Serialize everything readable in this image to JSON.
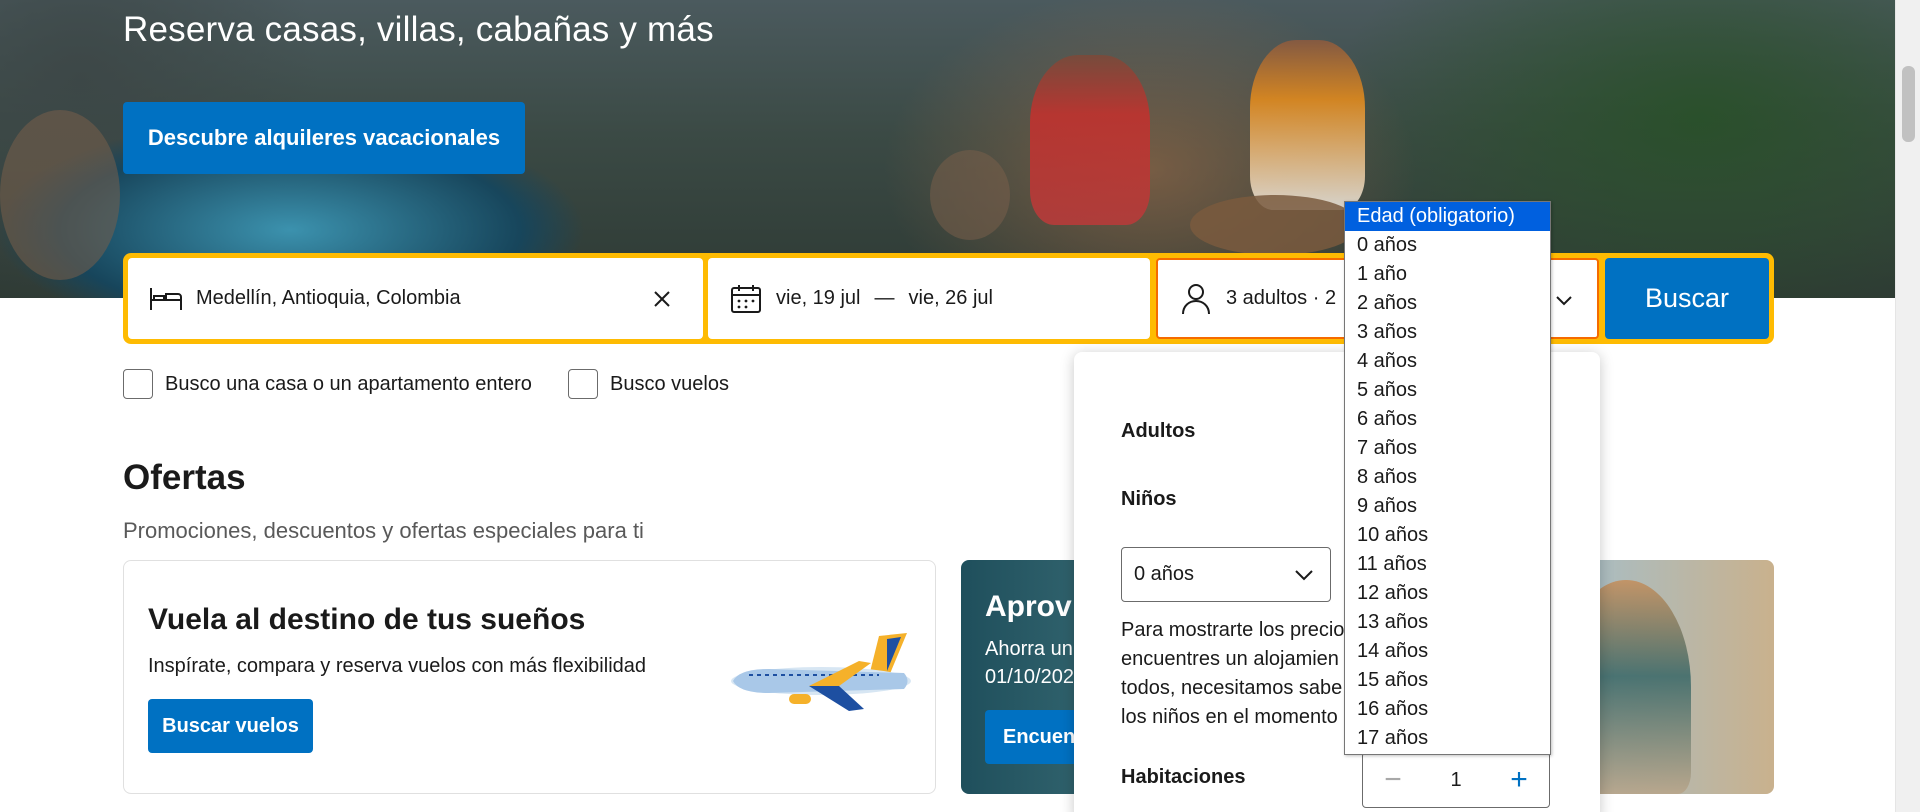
{
  "hero": {
    "title": "Reserva casas, villas, cabañas y más",
    "cta_label": "Descubre alquileres vacacionales"
  },
  "search": {
    "destination": "Medellín, Antioquia, Colombia",
    "check_in": "vie, 19 jul",
    "date_separator": "—",
    "check_out": "vie, 26 jul",
    "guests_summary": "3 adultos · 2",
    "search_label": "Buscar",
    "icons": {
      "destination": "bed-icon",
      "dates": "calendar-icon",
      "guests": "person-icon",
      "clear": "close-icon",
      "expand": "chevron-down-icon"
    },
    "accent_color": "#febb02",
    "button_color": "#0071c2"
  },
  "checkboxes": [
    {
      "label": "Busco una casa o un apartamento entero",
      "checked": false
    },
    {
      "label": "Busco vuelos",
      "checked": false
    }
  ],
  "offers": {
    "title": "Ofertas",
    "subtitle": "Promociones, descuentos y ofertas especiales para ti",
    "card_flights": {
      "title": "Vuela al destino de tus sueños",
      "text": "Inspírate, compara y reserva vuelos con más flexibilidad",
      "button": "Buscar vuelos"
    },
    "card_promo": {
      "title": "Aprov",
      "text_line1": "Ahorra un",
      "text_line2": "01/10/202",
      "button": "Encuent"
    }
  },
  "guest_panel": {
    "adults_label": "Adultos",
    "children_label": "Niños",
    "child_age_selected": "0 años",
    "note_lines": [
      "Para mostrarte los precio",
      "encuentres un alojamien",
      "todos, necesitamos sabe",
      "los niños en el momento"
    ],
    "rooms_label": "Habitaciones",
    "rooms_value": "1",
    "rooms_minus": "−",
    "rooms_plus": "+"
  },
  "age_dropdown": {
    "options": [
      "Edad (obligatorio)",
      "0 años",
      "1 año",
      "2 años",
      "3 años",
      "4 años",
      "5 años",
      "6 años",
      "7 años",
      "8 años",
      "9 años",
      "10 años",
      "11 años",
      "12 años",
      "13 años",
      "14 años",
      "15 años",
      "16 años",
      "17 años"
    ],
    "highlighted_index": 0
  }
}
